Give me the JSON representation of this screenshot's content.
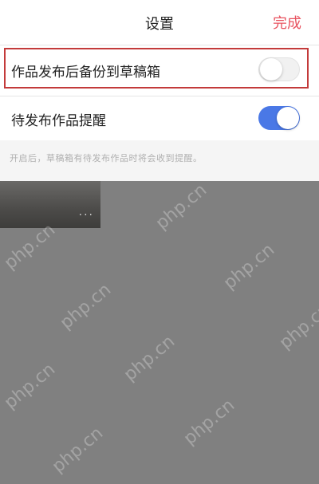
{
  "navbar": {
    "title": "设置",
    "done_label": "完成"
  },
  "settings": [
    {
      "label": "作品发布后备份到草稿箱",
      "enabled": false
    },
    {
      "label": "待发布作品提醒",
      "enabled": true
    }
  ],
  "hint": "开启后，草稿箱有待发布作品时将会收到提醒。",
  "thumbnail": {
    "more_label": "···"
  },
  "watermark_text": "php.cn",
  "colors": {
    "accent": "#e8525f",
    "toggle_on": "#4a78e6",
    "highlight_border": "#c33a3a",
    "overlay": "#808080"
  }
}
